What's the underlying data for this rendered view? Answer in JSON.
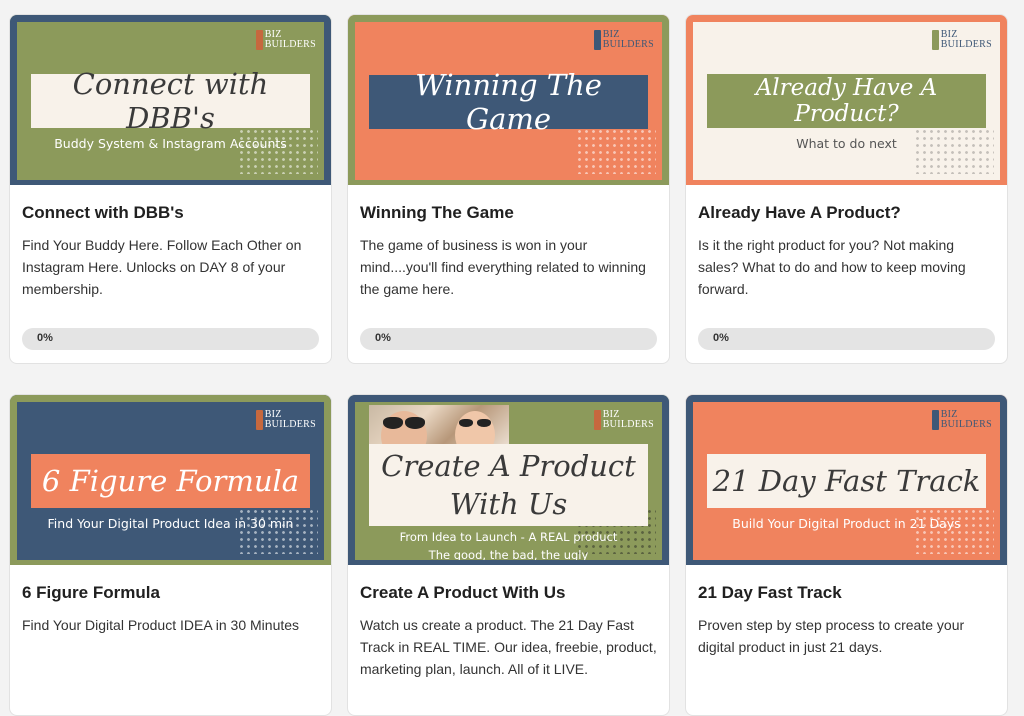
{
  "logo": {
    "line1": "BIZ",
    "line2": "BUILDERS"
  },
  "cards": [
    {
      "banner_title": "Connect with DBB's",
      "banner_subtitle": "Buddy System & Instagram Accounts",
      "title": "Connect with DBB's",
      "description": "Find Your Buddy Here. Follow Each Other on Instagram Here. Unlocks on DAY 8 of your membership.",
      "progress_label": "0%",
      "progress": 0
    },
    {
      "banner_title": "Winning The Game",
      "banner_subtitle": "",
      "title": "Winning The Game",
      "description": "The game of business is won in your mind....you'll find everything related to winning the game here.",
      "progress_label": "0%",
      "progress": 0
    },
    {
      "banner_title": "Already Have A Product?",
      "banner_subtitle": "What to do next",
      "title": "Already Have A Product?",
      "description": "Is it the right product for you? Not making sales? What to do and how to keep moving forward.",
      "progress_label": "0%",
      "progress": 0
    },
    {
      "banner_title": "6 Figure Formula",
      "banner_subtitle": "Find Your Digital Product Idea in 30 min",
      "title": "6 Figure Formula",
      "description": "Find Your Digital Product IDEA in 30 Minutes"
    },
    {
      "banner_title_line1": "Create A Product",
      "banner_title_line2": "With Us",
      "banner_subtitle_line1": "From Idea to Launch - A REAL product",
      "banner_subtitle_line2": "The good, the bad, the ugly",
      "title": "Create A Product With Us",
      "description": "Watch us create a product. The 21 Day Fast Track in REAL TIME. Our idea, freebie, product, marketing plan, launch. All of it LIVE."
    },
    {
      "banner_title": "21 Day Fast Track",
      "banner_subtitle": "Build Your Digital Product in 21 Days",
      "title": "21 Day Fast Track",
      "description": "Proven step by step process to create your digital product in just 21 days."
    }
  ],
  "colors": {
    "olive": "#8c9a5b",
    "navy": "#3e5877",
    "coral": "#f0835e",
    "cream": "#f8f2ea",
    "progress_track": "#e4e4e4"
  }
}
